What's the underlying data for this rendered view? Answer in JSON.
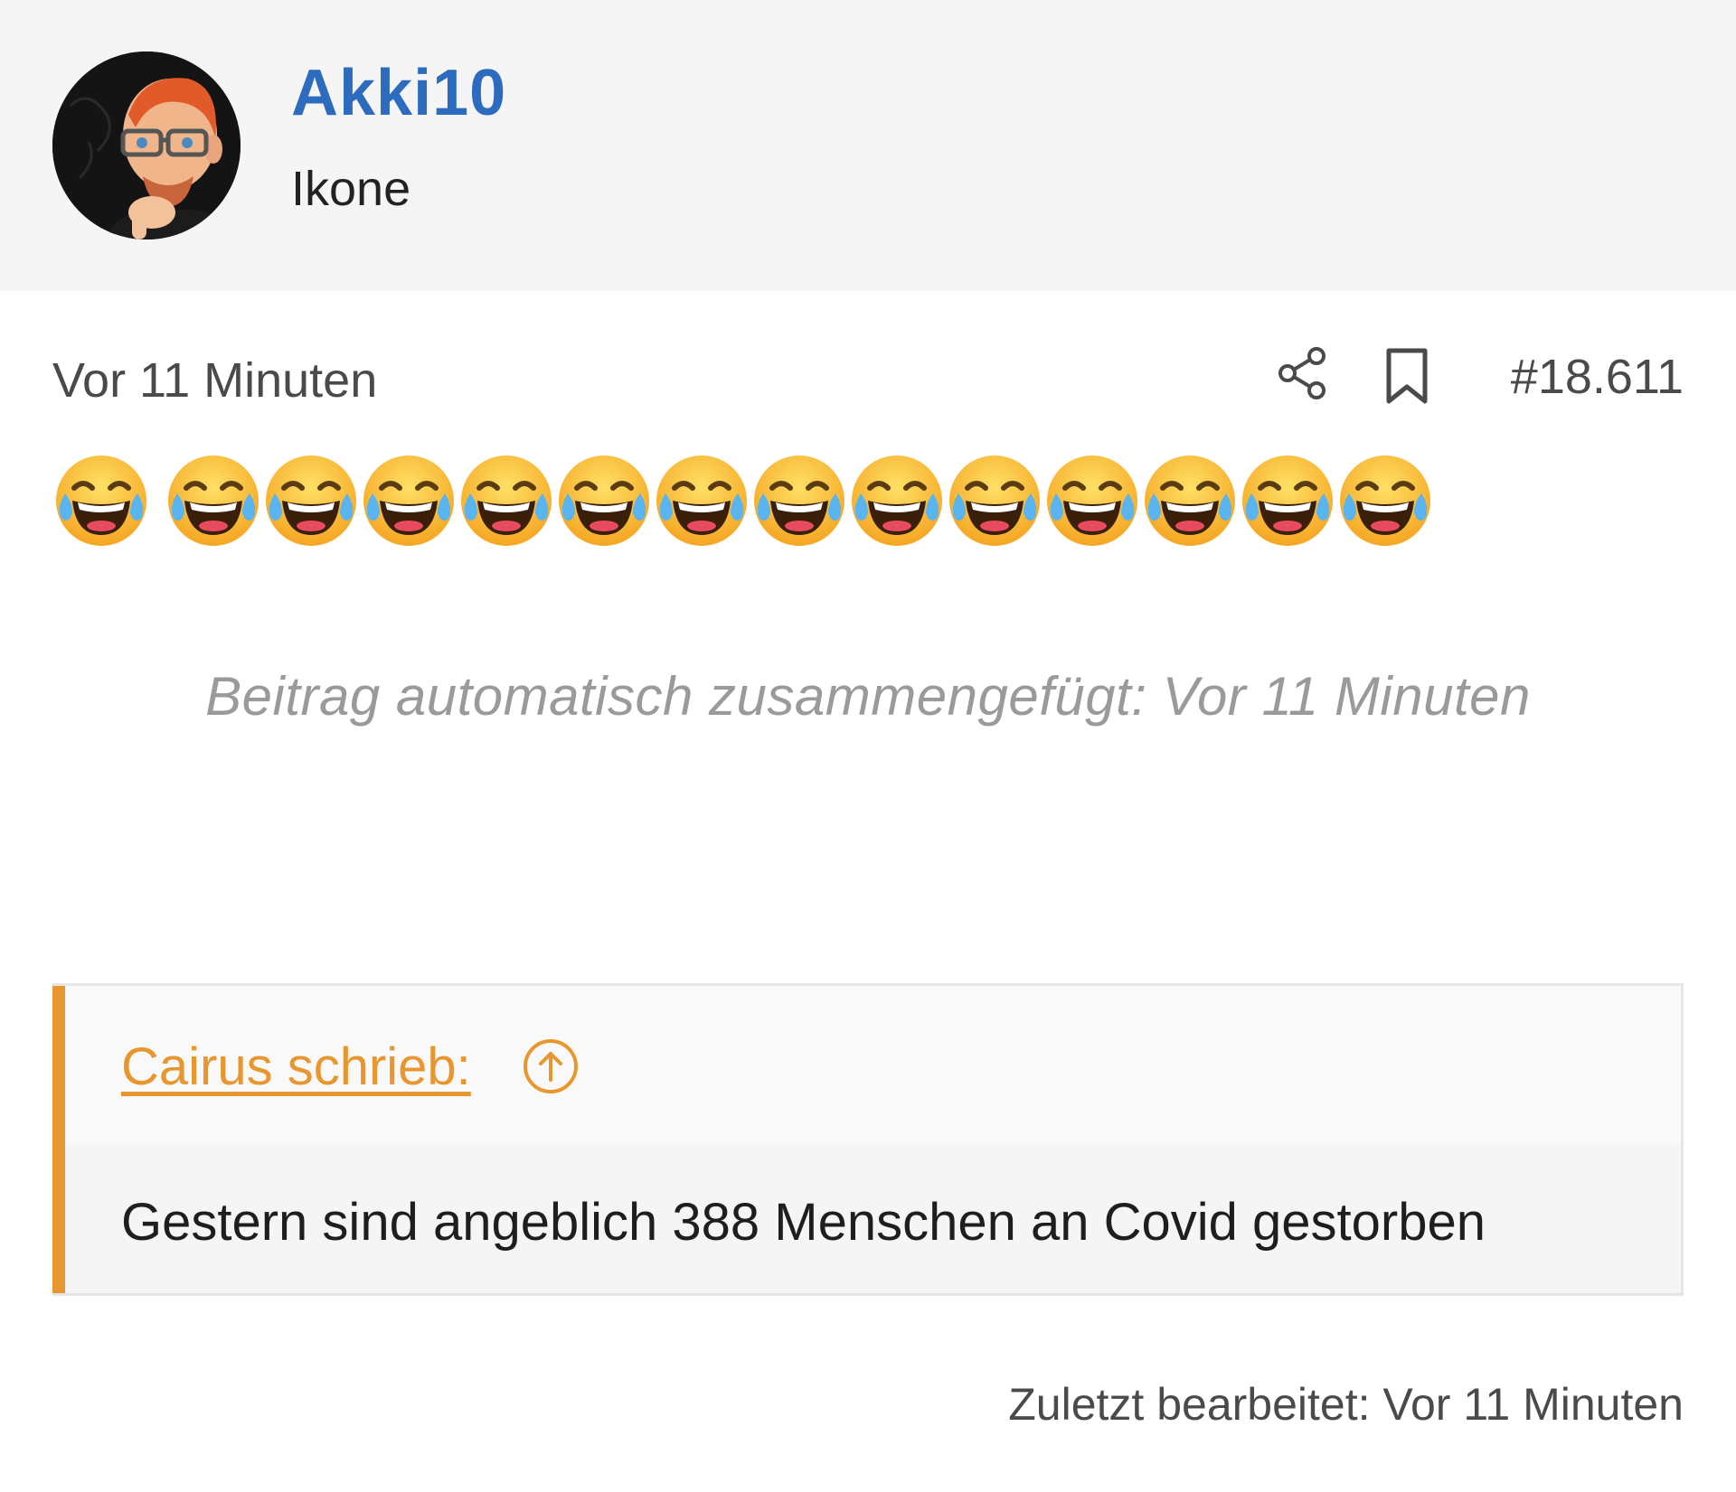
{
  "user": {
    "name": "Akki10",
    "title": "Ikone",
    "avatar_icon": "memoji-avatar-icon"
  },
  "post": {
    "time": "Vor 11 Minuten",
    "number": "#18.611",
    "share_icon": "share-icon",
    "bookmark_icon": "bookmark-icon",
    "emoji": "😂",
    "emoji_count": 14,
    "merge_note": "Beitrag automatisch zusammengefügt: Vor 11 Minuten",
    "last_edited": "Zuletzt bearbeitet: Vor 11 Minuten"
  },
  "quote": {
    "author_label": "Cairus schrieb:",
    "up_icon": "arrow-up-circle-icon",
    "text": "Gestern sind angeblich 388 Menschen an Covid gestorben"
  },
  "colors": {
    "username": "#2d6bbf",
    "quote_accent": "#e8962f",
    "header_bg": "#f5f5f5"
  }
}
